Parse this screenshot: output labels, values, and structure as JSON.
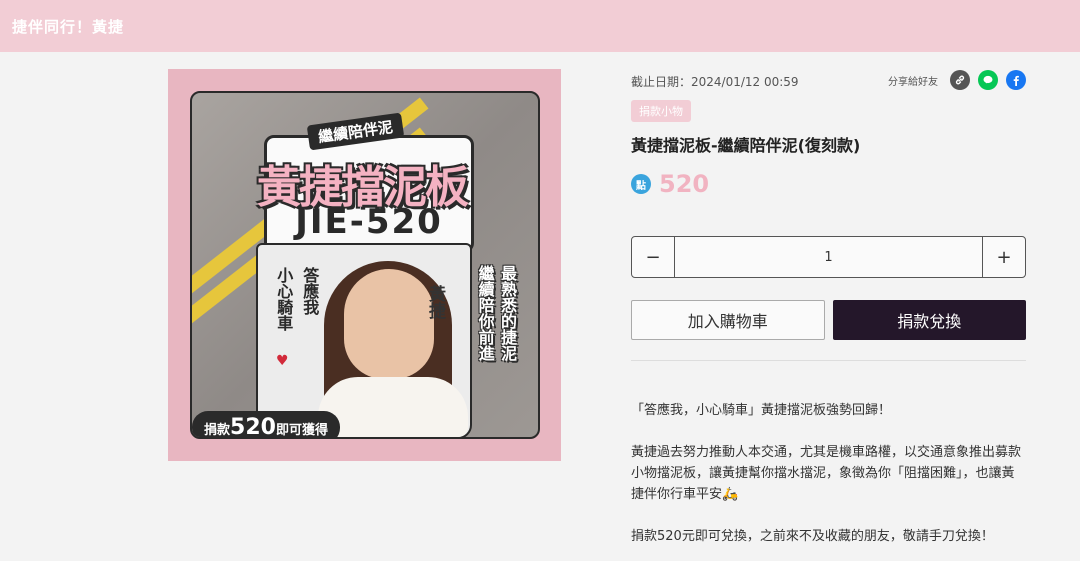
{
  "header": {
    "title": "捷伴同行！黃捷"
  },
  "image": {
    "subtitle": "繼續陪伴泥",
    "title": "黃捷擋泥板",
    "plate": "JIE-520",
    "card_text_1": "答應我",
    "card_text_2": "小心騎車",
    "signature": "黃捷",
    "side_text_1": "最熟悉的捷泥",
    "side_text_2": "繼續陪你前進",
    "badge_prefix": "捐款",
    "badge_value": "520",
    "badge_suffix": "即可獲得"
  },
  "product": {
    "deadline": "截止日期：2024/01/12 00:59",
    "share_label": "分享給好友",
    "tag": "捐款小物",
    "title": "黃捷擋泥板-繼續陪伴泥(復刻款)",
    "point_label": "點",
    "price": "520",
    "quantity": "1",
    "minus": "−",
    "plus": "+",
    "add_to_cart": "加入購物車",
    "donate_exchange": "捐款兌換"
  },
  "description": {
    "p1": "「答應我，小心騎車」黃捷擋泥板強勢回歸！",
    "p2": "黃捷過去努力推動人本交通，尤其是機車路權，以交通意象推出募款小物擋泥板，讓黃捷幫你擋水擋泥，象徵為你「阻擋困難」，也讓黃捷伴你行車平安🛵",
    "p3": "捐款520元即可兌換，之前來不及收藏的朋友，敬請手刀兌換！"
  },
  "icons": {
    "share_link": "link-icon",
    "share_line": "line-icon",
    "share_facebook": "facebook-icon"
  },
  "colors": {
    "brand_pink": "#f2cdd5",
    "price_pink": "#f1b3c1",
    "donate_button": "#24172a",
    "point_blue": "#3aa4dd",
    "line_green": "#06c755",
    "facebook_blue": "#1877f2"
  }
}
